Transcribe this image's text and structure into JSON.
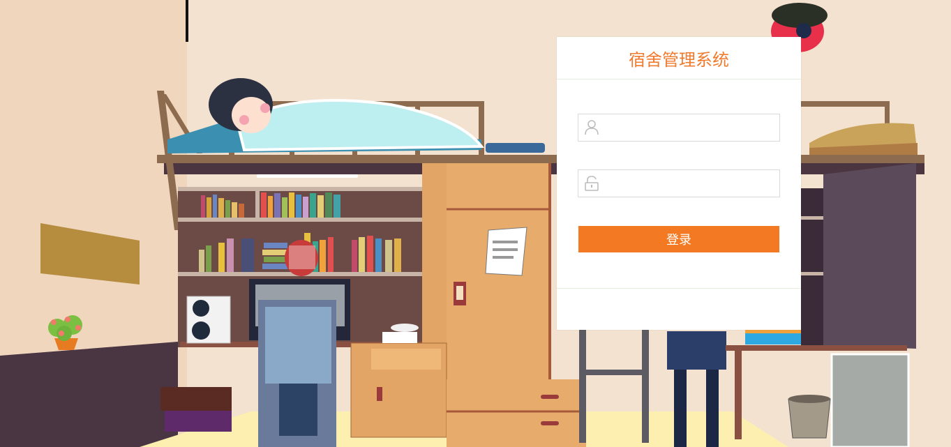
{
  "login": {
    "title": "宿舍管理系统",
    "username": {
      "value": "",
      "placeholder": "",
      "icon": "user-icon"
    },
    "password": {
      "value": "",
      "placeholder": "",
      "icon": "unlock-icon"
    },
    "submit_label": "登录"
  },
  "colors": {
    "accent": "#f37a22",
    "title": "#f07a2d",
    "wall": "#f3e2d0",
    "floor": "#fdf1b0",
    "cabinet": "#e3a565"
  }
}
